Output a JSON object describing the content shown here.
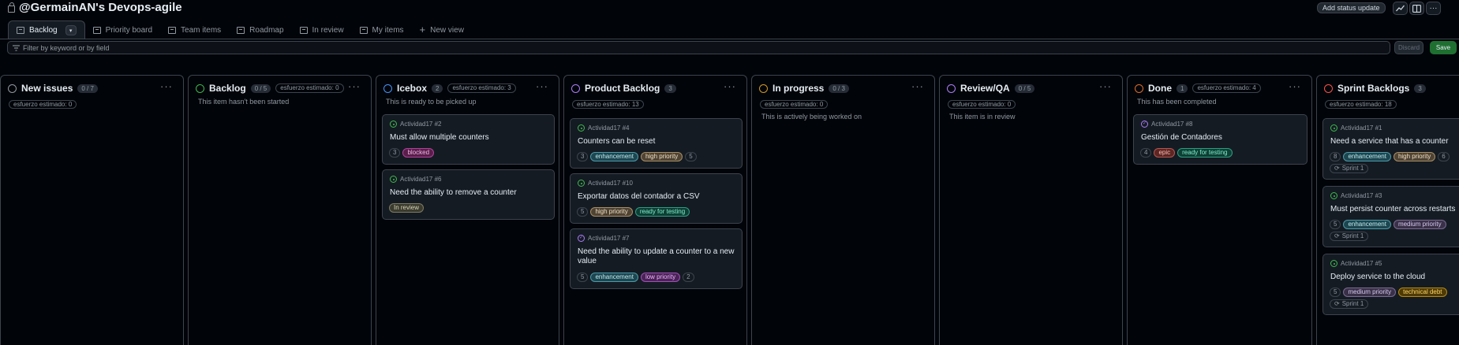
{
  "header": {
    "title": "@GermainAN's Devops-agile",
    "status_button": "Add status update",
    "icons": [
      "insights-icon",
      "layout-icon",
      "more-icon"
    ]
  },
  "tabs": [
    {
      "label": "Backlog",
      "active": true
    },
    {
      "label": "Priority board"
    },
    {
      "label": "Team items"
    },
    {
      "label": "Roadmap"
    },
    {
      "label": "In review"
    },
    {
      "label": "My items"
    },
    {
      "label": "New view"
    }
  ],
  "filter": {
    "placeholder": "Filter by keyword or by field",
    "discard_label": "Discard",
    "save_label": "Save"
  },
  "colors": {
    "background": "#010409",
    "card": "#151b23",
    "border": "#3d444d",
    "save": "#1f6f31"
  },
  "columns": [
    {
      "name": "New issues",
      "count": "0 / 7",
      "estimate": "esfuerzo estimado: 0",
      "description": "",
      "ring": "#9198a1"
    },
    {
      "name": "Backlog",
      "count": "0 / 5",
      "estimate": "esfuerzo estimado: 0",
      "description": "This item hasn't been started",
      "ring": "#3fb950"
    },
    {
      "name": "Icebox",
      "count": "2",
      "estimate": "esfuerzo estimado: 3",
      "description": "This is ready to be picked up",
      "ring": "#4493f8"
    },
    {
      "name": "Product Backlog",
      "count": "3",
      "estimate": "esfuerzo estimado: 13",
      "description": "",
      "ring": "#ab7df8"
    },
    {
      "name": "In progress",
      "count": "0 / 3",
      "estimate": "esfuerzo estimado: 0",
      "description": "This is actively being worked on",
      "ring": "#d29922"
    },
    {
      "name": "Review/QA",
      "count": "0 / 5",
      "estimate": "esfuerzo estimado: 0",
      "description": "This item is in review",
      "ring": "#ab7df8"
    },
    {
      "name": "Done",
      "count": "1",
      "estimate": "esfuerzo estimado: 4",
      "description": "This has been completed",
      "ring": "#db6d28"
    },
    {
      "name": "Sprint Backlogs",
      "count": "3",
      "estimate": "esfuerzo estimado: 18",
      "description": "",
      "ring": "#f85149"
    }
  ],
  "cards": {
    "icebox": [
      {
        "ref": "Actividad17 #2",
        "title": "Must allow multiple counters",
        "num": "3",
        "labels": [
          "blocked"
        ]
      },
      {
        "ref": "Actividad17 #6",
        "title": "Need the ability to remove a counter",
        "labels": [
          "In review"
        ]
      }
    ],
    "product_backlog": [
      {
        "ref": "Actividad17 #4",
        "title": "Counters can be reset",
        "num": "3",
        "labels": [
          "enhancement",
          "high priority"
        ],
        "extra": "5"
      },
      {
        "ref": "Actividad17 #10",
        "title": "Exportar datos del contador a CSV",
        "num": "5",
        "labels": [
          "high priority",
          "ready for testing"
        ]
      },
      {
        "ref": "Actividad17 #7",
        "title": "Need the ability to update a counter to a new value",
        "num": "5",
        "labels": [
          "enhancement",
          "low priority"
        ],
        "extra": "2"
      }
    ],
    "done": [
      {
        "ref": "Actividad17 #8",
        "title": "Gestión de Contadores",
        "num": "4",
        "labels": [
          "epic",
          "ready for testing"
        ]
      }
    ],
    "sprint": [
      {
        "ref": "Actividad17 #1",
        "title": "Need a service that has a counter",
        "num": "8",
        "labels": [
          "enhancement",
          "high priority"
        ],
        "extra": "6",
        "sprint": "Sprint 1"
      },
      {
        "ref": "Actividad17 #3",
        "title": "Must persist counter across restarts",
        "num": "5",
        "labels": [
          "enhancement",
          "medium priority"
        ],
        "sprint": "Sprint 1"
      },
      {
        "ref": "Actividad17 #5",
        "title": "Deploy service to the cloud",
        "num": "5",
        "labels": [
          "medium priority",
          "technical debt"
        ],
        "sprint": "Sprint 1"
      }
    ]
  }
}
